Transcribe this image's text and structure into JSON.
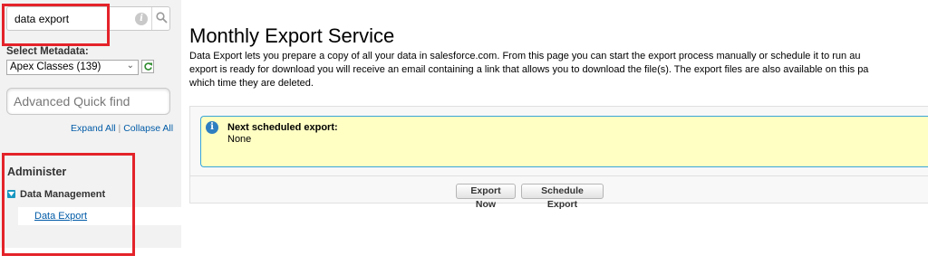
{
  "sidebar": {
    "search": {
      "value": "data export"
    },
    "metadata": {
      "label": "Select Metadata:",
      "selected": "Apex Classes (139)"
    },
    "advanced_find": {
      "placeholder": "Advanced Quick find"
    },
    "expand_all": "Expand All",
    "separator": "|",
    "collapse_all": "Collapse All",
    "section": "Administer",
    "group": "Data Management",
    "item": "Data Export"
  },
  "main": {
    "title": "Monthly Export Service",
    "description_lines": [
      "Data Export lets you prepare a copy of all your data in salesforce.com. From this page you can start the export process manually or schedule it to run au",
      "export is ready for download you will receive an email containing a link that allows you to download the file(s). The export files are also available on this pa",
      "which time they are deleted."
    ],
    "info": {
      "title": "Next scheduled export:",
      "value": "None"
    },
    "buttons": {
      "export_now": "Export Now",
      "schedule_export": "Schedule Export"
    }
  },
  "colors": {
    "highlight": "#e4232a",
    "link": "#015ba7",
    "info_bg": "#ffffc4",
    "info_border": "#39a5d8"
  },
  "icons": [
    "info-icon",
    "search-icon",
    "chevron-down-icon",
    "refresh-icon",
    "collapse-toggle-icon",
    "info-circle-icon"
  ]
}
